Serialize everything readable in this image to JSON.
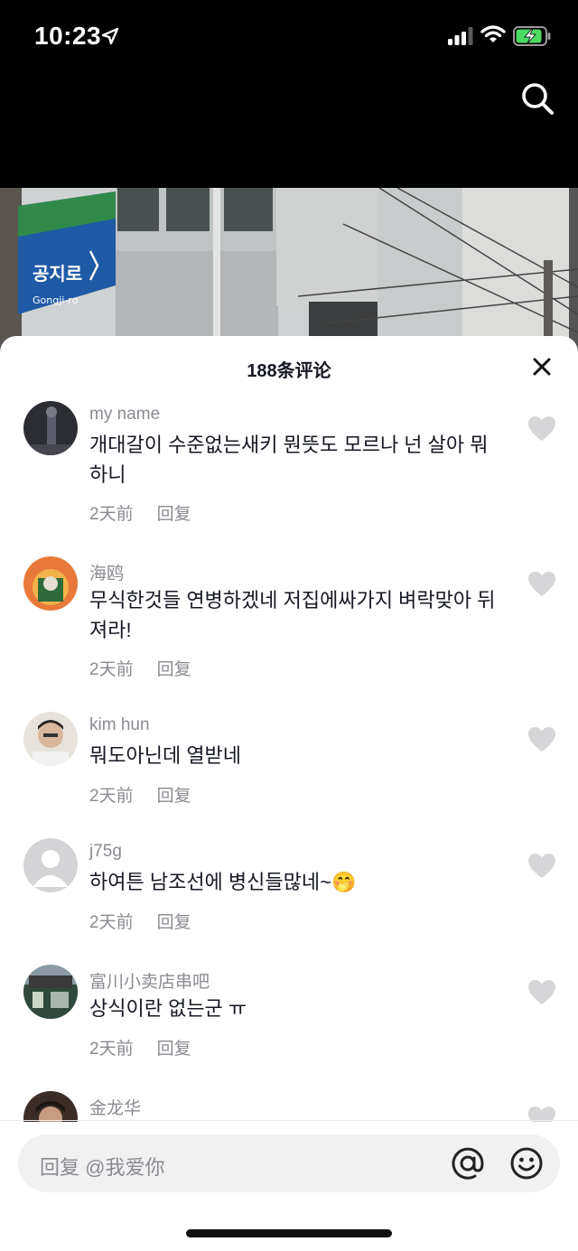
{
  "status_bar": {
    "time": "10:23"
  },
  "sign": {
    "name_ko": "공지로",
    "name_en": "Gongji-ro"
  },
  "sheet": {
    "title": "188条评论"
  },
  "comments": [
    {
      "name": "my name",
      "text": "개대갈이 수준없는새키  뭔뜻도 모르나 넌 살아 뭐하니",
      "time": "2天前",
      "reply": "回复"
    },
    {
      "name": "海鸥",
      "text": "무식한것들 연병하겠네 저집에싸가지 벼락맞아 뒤져라!",
      "time": "2天前",
      "reply": "回复"
    },
    {
      "name": "kim hun",
      "text": "뭐도아닌데 열받네",
      "time": "2天前",
      "reply": "回复"
    },
    {
      "name": "j75g",
      "text": "하여튼 남조선에 병신들많네~",
      "emoji": "🤭",
      "time": "2天前",
      "reply": "回复"
    },
    {
      "name": "富川小卖店串吧",
      "text": "상식이란 없는군 ㅠ",
      "time": "2天前",
      "reply": "回复"
    },
    {
      "name": "金龙华"
    }
  ],
  "input": {
    "placeholder": "回复 @我爱你"
  },
  "icons": {
    "location": "location-arrow-icon",
    "signal": "cellular-signal-icon",
    "wifi": "wifi-icon",
    "battery": "battery-charging-icon",
    "search": "search-icon",
    "close": "close-icon",
    "like": "heart-icon",
    "mention": "at-icon",
    "emoji": "emoji-icon"
  },
  "colors": {
    "battery": "#4cd964",
    "meta_text": "#8a8b91",
    "heart": "#d6d6d8"
  }
}
